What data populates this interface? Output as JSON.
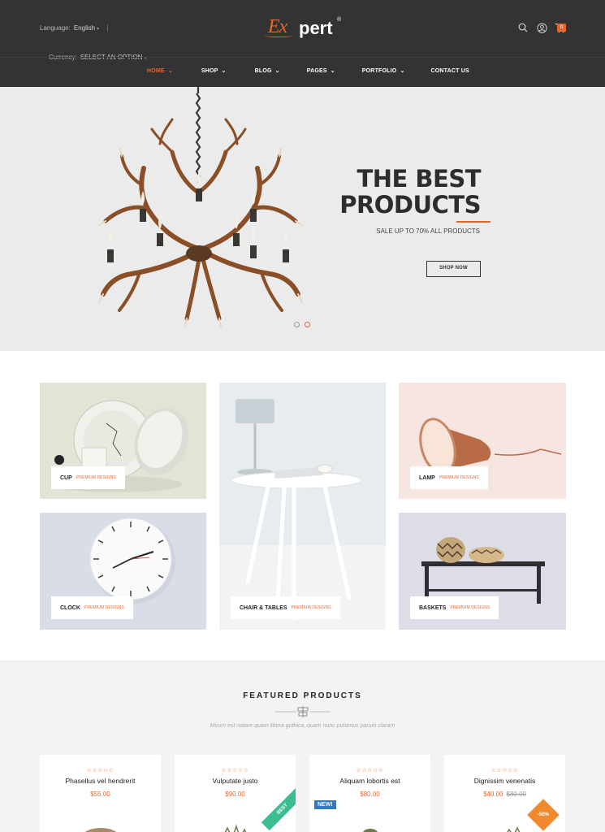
{
  "header": {
    "language_label": "Language:",
    "language_value": "English",
    "currency_label": "Currency:",
    "currency_value": "SELECT AN OPTION",
    "logo_part1": "Ex",
    "logo_part2": "pert",
    "logo_mark": "®",
    "cart_count": "0",
    "icons": [
      "search-icon",
      "user-icon",
      "cart-icon"
    ],
    "nav": [
      {
        "label": "HOME",
        "active": true
      },
      {
        "label": "SHOP"
      },
      {
        "label": "BLOG"
      },
      {
        "label": "PAGES"
      },
      {
        "label": "PORTFOLIO"
      },
      {
        "label": "CONTACT US"
      }
    ]
  },
  "hero": {
    "title_line1": "THE BEST",
    "title_line2": "PRODUCTS",
    "subtitle": "SALE UP TO 70% ALL PRODUCTS",
    "cta": "SHOP NOW",
    "slides": 2,
    "active_slide": 2
  },
  "categories": [
    {
      "name": "CUP",
      "tag": "PREMIUM DESIGNS"
    },
    {
      "name": "CHAIR & TABLES",
      "tag": "PREMIUM DESIGNS"
    },
    {
      "name": "LAMP",
      "tag": "PREMIUM DESIGNS"
    },
    {
      "name": "CLOCK",
      "tag": "PREMIUM DESIGNS"
    },
    {
      "name": "BASKETS",
      "tag": "PREMIUM DESIGNS"
    }
  ],
  "featured": {
    "title": "FEATURED PRODUCTS",
    "description": "Mirum est notare quam littera gothica, quam nunc putamus parum claram",
    "products": [
      {
        "name": "Phasellus vel hendrerit",
        "price": "$55.00",
        "old_price": "",
        "rating": "☆☆☆☆☆",
        "badge": ""
      },
      {
        "name": "Vulputate justo",
        "price": "$90.00",
        "old_price": "",
        "rating": "☆☆☆☆☆",
        "badge": "BEST"
      },
      {
        "name": "Aliquam lobortis est",
        "price": "$80.00",
        "old_price": "",
        "rating": "☆☆☆☆☆",
        "badge": "NEW!"
      },
      {
        "name": "Dignissim venenatis",
        "price": "$40.00",
        "old_price": "$80.00",
        "rating": "☆☆☆☆☆",
        "badge": "-50%"
      }
    ]
  },
  "colors": {
    "accent": "#e8652c",
    "header_bg": "#333333",
    "new_badge": "#2f78c4",
    "best_badge": "#3cbd8f",
    "sale_badge": "#f08a2c"
  }
}
